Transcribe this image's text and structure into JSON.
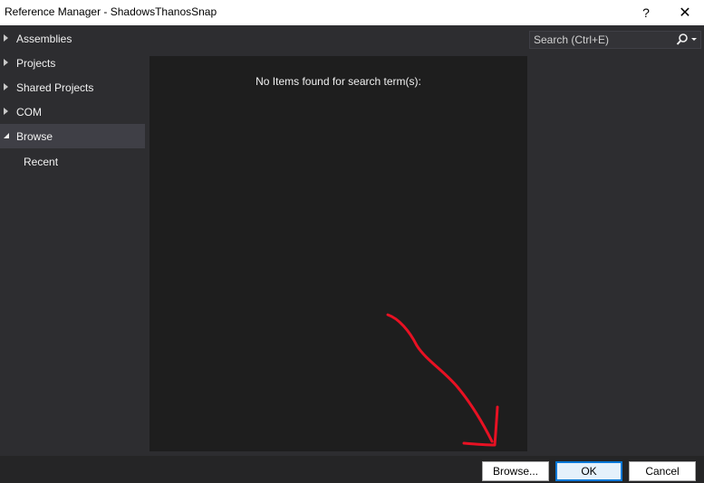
{
  "window": {
    "title": "Reference Manager - ShadowsThanosSnap",
    "help_glyph": "?",
    "close_glyph": "✕"
  },
  "sidebar": {
    "items": [
      {
        "label": "Assemblies",
        "expanded": false
      },
      {
        "label": "Projects",
        "expanded": false
      },
      {
        "label": "Shared Projects",
        "expanded": false
      },
      {
        "label": "COM",
        "expanded": false
      },
      {
        "label": "Browse",
        "expanded": true,
        "selected": true
      }
    ],
    "sub_items": [
      {
        "label": "Recent"
      }
    ]
  },
  "main": {
    "empty_message": "No Items found for search term(s):"
  },
  "search": {
    "placeholder": "Search (Ctrl+E)",
    "value": ""
  },
  "buttons": {
    "browse": "Browse...",
    "ok": "OK",
    "cancel": "Cancel"
  },
  "colors": {
    "background": "#2d2d30",
    "panel": "#1e1e1e",
    "selected": "#3f3f46",
    "annotation": "#e81123"
  }
}
